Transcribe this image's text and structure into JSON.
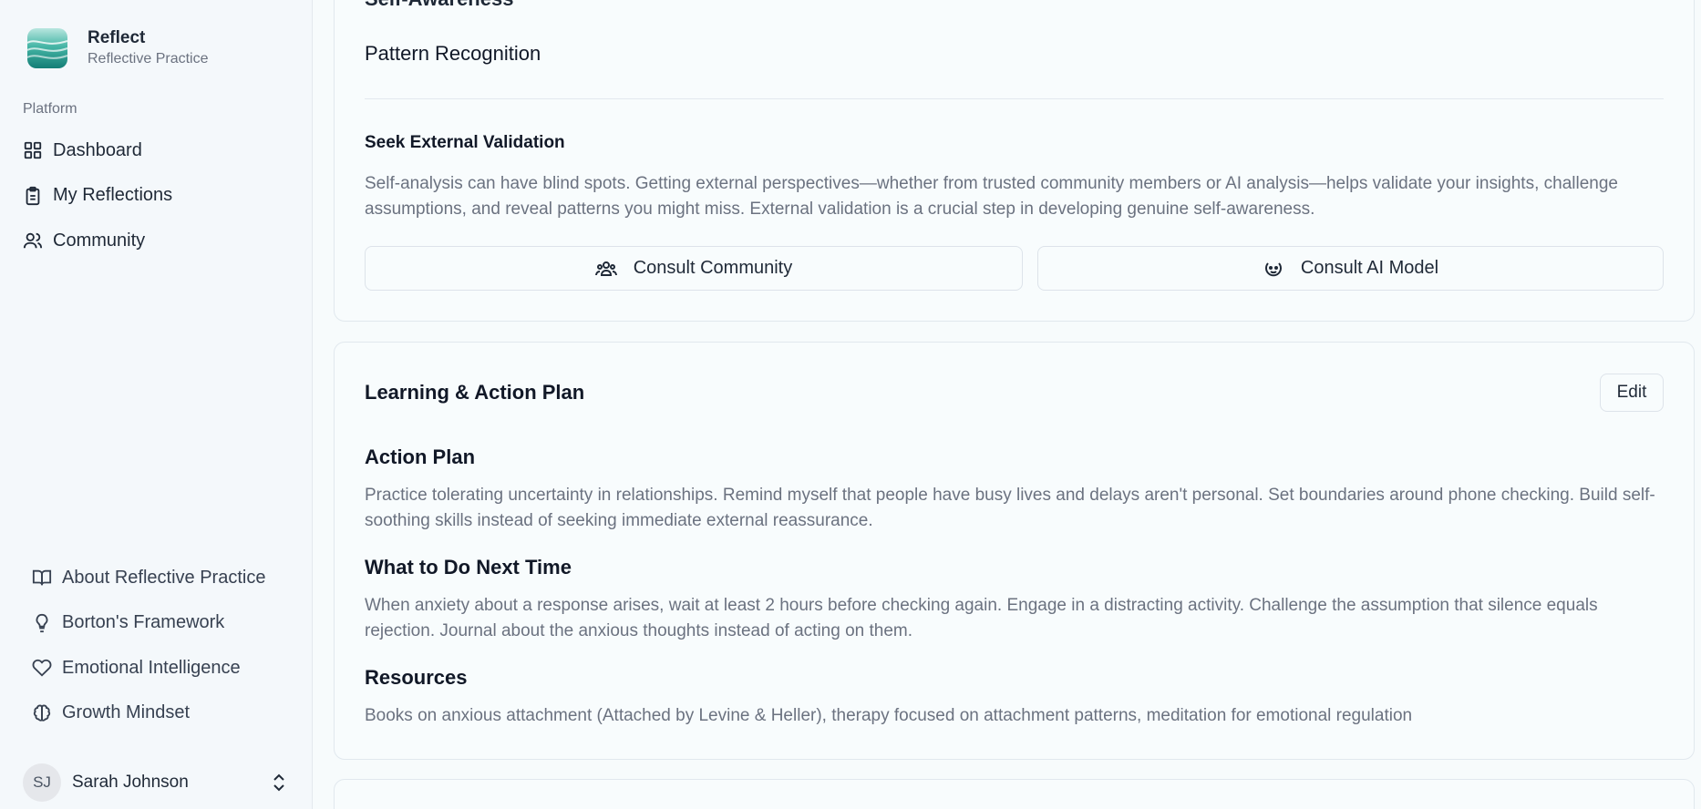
{
  "brand": {
    "name": "Reflect",
    "subtitle": "Reflective Practice"
  },
  "sidebar": {
    "group_label": "Platform",
    "items": [
      {
        "label": "Dashboard",
        "icon": "grid-icon"
      },
      {
        "label": "My Reflections",
        "icon": "clipboard-icon"
      },
      {
        "label": "Community",
        "icon": "users-icon"
      }
    ],
    "bottom_items": [
      {
        "label": "About Reflective Practice",
        "icon": "book-open-icon"
      },
      {
        "label": "Borton's Framework",
        "icon": "lightbulb-icon"
      },
      {
        "label": "Emotional Intelligence",
        "icon": "heart-icon"
      },
      {
        "label": "Growth Mindset",
        "icon": "brain-icon"
      }
    ],
    "user": {
      "initials": "SJ",
      "name": "Sarah Johnson"
    }
  },
  "main": {
    "card1": {
      "clipped_heading": "Self-Awareness",
      "section_title": "Pattern Recognition",
      "validation_title": "Seek External Validation",
      "validation_text": "Self-analysis can have blind spots. Getting external perspectives—whether from trusted community members or AI analysis—helps validate your insights, challenge assumptions, and reveal patterns you might miss. External validation is a crucial step in developing genuine self-awareness.",
      "consult_community": "Consult Community",
      "consult_ai": "Consult AI Model"
    },
    "card2": {
      "title": "Learning & Action Plan",
      "edit_label": "Edit",
      "action_plan_title": "Action Plan",
      "action_plan_text": "Practice tolerating uncertainty in relationships. Remind myself that people have busy lives and delays aren't personal. Set boundaries around phone checking. Build self-soothing skills instead of seeking immediate external reassurance.",
      "next_time_title": "What to Do Next Time",
      "next_time_text": "When anxiety about a response arises, wait at least 2 hours before checking again. Engage in a distracting activity. Challenge the assumption that silence equals rejection. Journal about the anxious thoughts instead of acting on them.",
      "resources_title": "Resources",
      "resources_text": "Books on anxious attachment (Attached by Levine & Heller), therapy focused on attachment patterns, meditation for emotional regulation"
    }
  }
}
